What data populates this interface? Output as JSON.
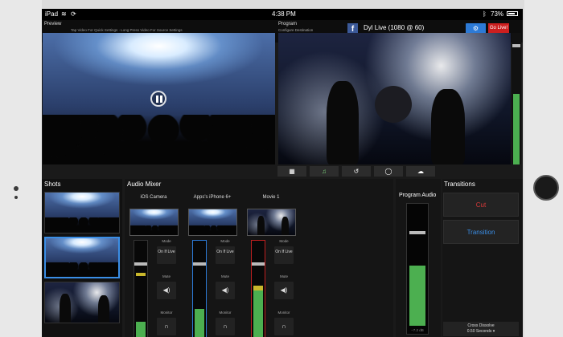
{
  "status_bar": {
    "device": "iPad",
    "time": "4:38 PM",
    "battery": "73%"
  },
  "header": {
    "preview_title": "Preview",
    "preview_hint": "Tap Video For Quick Settings  ·  Long Press Video For Source Settings",
    "program_title": "Program",
    "configure_destination": "Configure Destination",
    "facebook_icon_label": "f",
    "destination_label": "Dyl Live  (1080 @ 60)",
    "share_icon_label": "⚙",
    "go_live_label": "Go Live!"
  },
  "toolbar": {
    "items": [
      {
        "name": "grid-icon",
        "glyph": "▦"
      },
      {
        "name": "music-icon",
        "glyph": "♫"
      },
      {
        "name": "replay-icon",
        "glyph": "↺"
      },
      {
        "name": "record-icon",
        "glyph": "◯"
      },
      {
        "name": "cloud-icon",
        "glyph": "☁"
      }
    ]
  },
  "sections": {
    "shots": "Shots",
    "audio_mixer": "Audio Mixer",
    "program_audio": "Program Audio",
    "transitions": "Transitions"
  },
  "channels": [
    {
      "name": "iOS Camera",
      "mode_label": "Mode",
      "mode_value": "On If Live",
      "mute_label": "Mute",
      "monitor_label": "Monitor",
      "level": 0.22,
      "fader": 0.78
    },
    {
      "name": "Apps's iPhone 6+",
      "mode_label": "Mode",
      "mode_value": "On If Live",
      "mute_label": "Mute",
      "monitor_label": "Monitor",
      "level": 0.35,
      "fader": 0.78
    },
    {
      "name": "Movie 1",
      "mode_label": "Mode",
      "mode_value": "On If Live",
      "mute_label": "Mute",
      "monitor_label": "Monitor",
      "level": 0.55,
      "fader": 0.78
    }
  ],
  "program_audio": {
    "db": "−7.2 dB",
    "level": 0.48,
    "fader": 0.78
  },
  "transitions": {
    "cut_label": "Cut",
    "transition_label": "Transition",
    "cross_dissolve": "Cross Dissolve",
    "duration": "0.50 Seconds ▾"
  },
  "colors": {
    "go_live": "#cc1f1f",
    "accent_blue": "#2d7ad6",
    "meter_green": "#4caf50",
    "cut_red": "#d83a3a",
    "transition_blue": "#3a8ee6"
  }
}
